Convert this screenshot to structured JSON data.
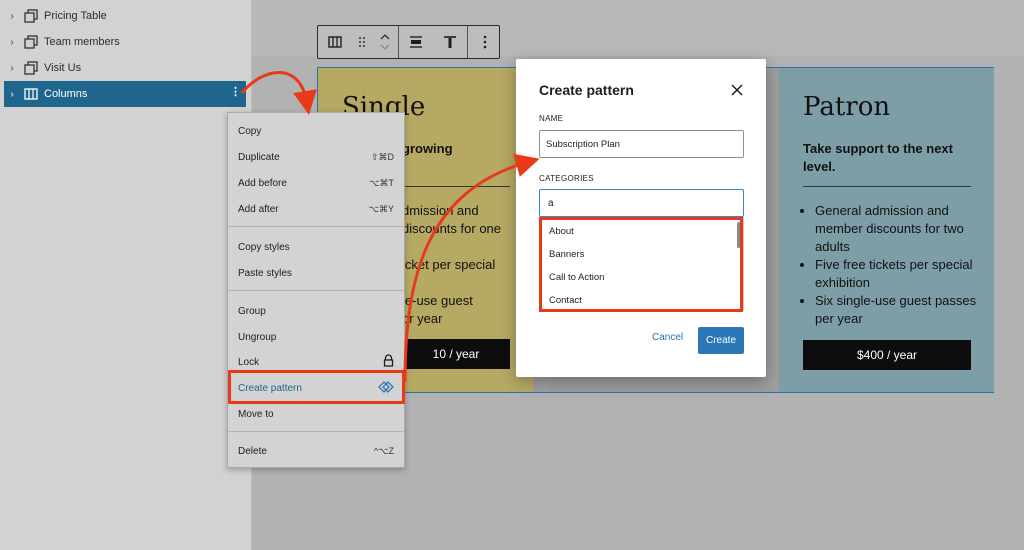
{
  "list_view": {
    "items": [
      {
        "label": "Pricing Table"
      },
      {
        "label": "Team members"
      },
      {
        "label": "Visit Us"
      },
      {
        "label": "Columns"
      }
    ]
  },
  "columns": {
    "single": {
      "title": "Single",
      "subtitle": "growing",
      "bullets": [
        "dmission and",
        "discounts for one",
        "icket per special",
        "le-use guest",
        "or year"
      ],
      "price": "10 / year"
    },
    "patron": {
      "title": "Patron",
      "subtitle": "Take support to the next level.",
      "bullets": [
        "General admission and member discounts for two adults",
        "Five free tickets per special exhibition",
        "Six single-use guest passes per year"
      ],
      "price": "$400 / year"
    }
  },
  "context_menu": {
    "items": [
      {
        "label": "Copy",
        "shortcut": ""
      },
      {
        "label": "Duplicate",
        "shortcut": "⇧⌘D"
      },
      {
        "label": "Add before",
        "shortcut": "⌥⌘T"
      },
      {
        "label": "Add after",
        "shortcut": "⌥⌘Y"
      },
      {
        "label": "Copy styles",
        "shortcut": ""
      },
      {
        "label": "Paste styles",
        "shortcut": ""
      },
      {
        "label": "Group",
        "shortcut": ""
      },
      {
        "label": "Ungroup",
        "shortcut": ""
      },
      {
        "label": "Lock",
        "shortcut": ""
      },
      {
        "label": "Create pattern",
        "shortcut": ""
      },
      {
        "label": "Move to",
        "shortcut": ""
      },
      {
        "label": "Delete",
        "shortcut": "^⌥Z"
      }
    ]
  },
  "modal": {
    "title": "Create pattern",
    "name_label": "NAME",
    "name_value": "Subscription Plan",
    "categories_label": "CATEGORIES",
    "categories_value": "a",
    "suggestions": [
      "About",
      "Banners",
      "Call to Action",
      "Contact"
    ],
    "cancel_label": "Cancel",
    "create_label": "Create"
  },
  "colors": {
    "accent": "#2a78b7",
    "selected": "#1f668c",
    "highlight": "#e83a18"
  }
}
